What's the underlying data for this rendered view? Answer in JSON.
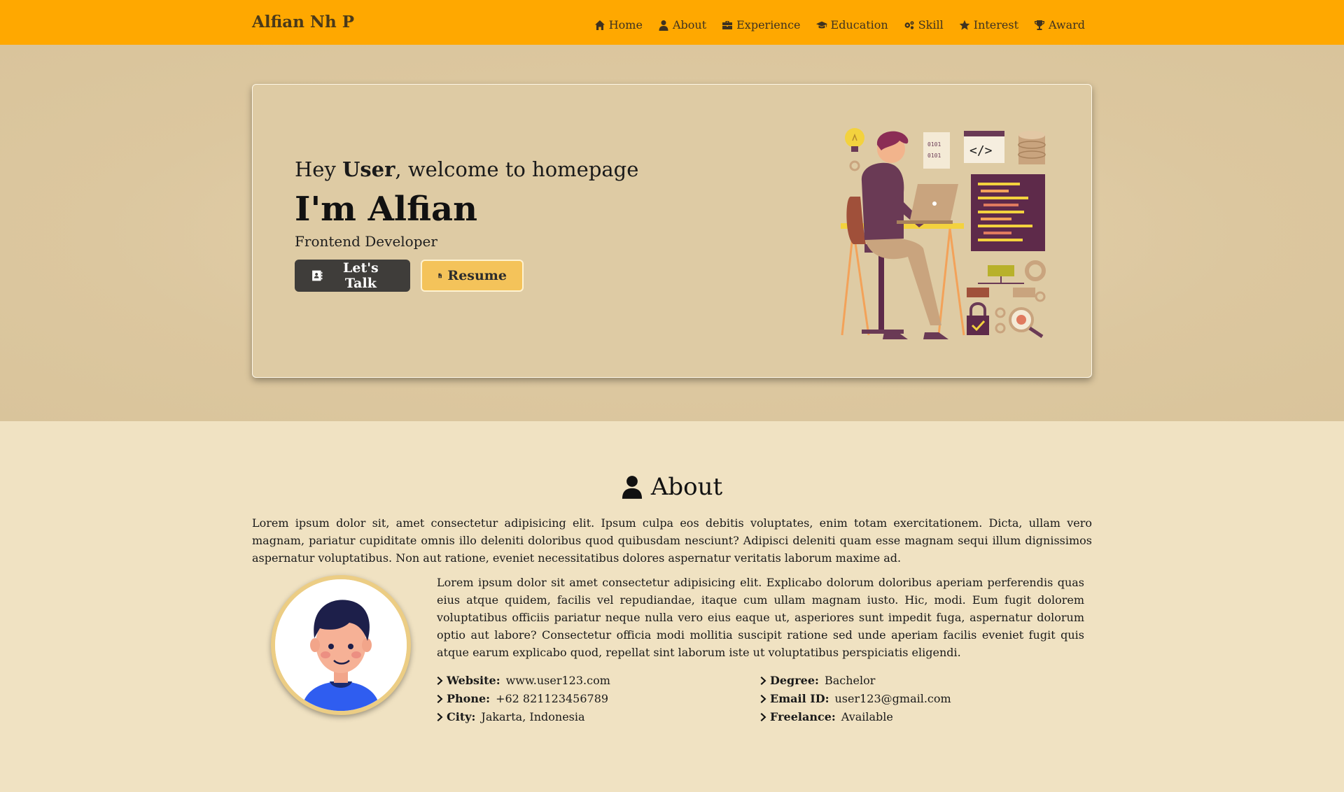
{
  "navbar": {
    "brand": "Alfian Nh P",
    "links": [
      {
        "label": "Home",
        "icon": "home-icon"
      },
      {
        "label": "About",
        "icon": "user-icon"
      },
      {
        "label": "Experience",
        "icon": "briefcase-icon"
      },
      {
        "label": "Education",
        "icon": "graduation-cap-icon"
      },
      {
        "label": "Skill",
        "icon": "gears-icon"
      },
      {
        "label": "Interest",
        "icon": "star-icon"
      },
      {
        "label": "Award",
        "icon": "trophy-icon"
      }
    ]
  },
  "hero": {
    "greeting_prefix": "Hey ",
    "greeting_user": "User",
    "greeting_suffix": ", welcome to homepage",
    "name": "I'm Alfian",
    "role": "Frontend Developer",
    "talk_button": "Let's Talk",
    "resume_button": "Resume"
  },
  "about": {
    "heading": "About",
    "intro": "Lorem ipsum dolor sit, amet consectetur adipisicing elit. Ipsum culpa eos debitis voluptates, enim totam exercitationem. Dicta, ullam vero magnam, pariatur cupiditate omnis illo deleniti doloribus quod quibusdam nesciunt? Adipisci deleniti quam esse magnam sequi illum dignissimos aspernatur voluptatibus. Non aut ratione, eveniet necessitatibus dolores aspernatur veritatis laborum maxime ad.",
    "body": "Lorem ipsum dolor sit amet consectetur adipisicing elit. Explicabo dolorum doloribus aperiam perferendis quas eius atque quidem, facilis vel repudiandae, itaque cum ullam magnam iusto. Hic, modi. Eum fugit dolorem voluptatibus officiis pariatur neque nulla vero eius eaque ut, asperiores sunt impedit fuga, aspernatur dolorum optio aut labore? Consectetur officia modi mollitia suscipit ratione sed unde aperiam facilis eveniet fugit quis atque earum explicabo quod, repellat sint laborum iste ut voluptatibus perspiciatis eligendi.",
    "details_left": [
      {
        "label": "Website:",
        "value": "www.user123.com"
      },
      {
        "label": "Phone:",
        "value": "+62 821123456789"
      },
      {
        "label": "City:",
        "value": "Jakarta, Indonesia"
      }
    ],
    "details_right": [
      {
        "label": "Degree:",
        "value": "Bachelor"
      },
      {
        "label": "Email ID:",
        "value": "user123@gmail.com"
      },
      {
        "label": "Freelance:",
        "value": "Available"
      }
    ]
  },
  "colors": {
    "navbar": "#ffa800",
    "hero_bg": "#decba4",
    "page_bg": "#f0e2c2",
    "talk_button": "#3f3d3a",
    "resume_button": "#f4c35a"
  }
}
